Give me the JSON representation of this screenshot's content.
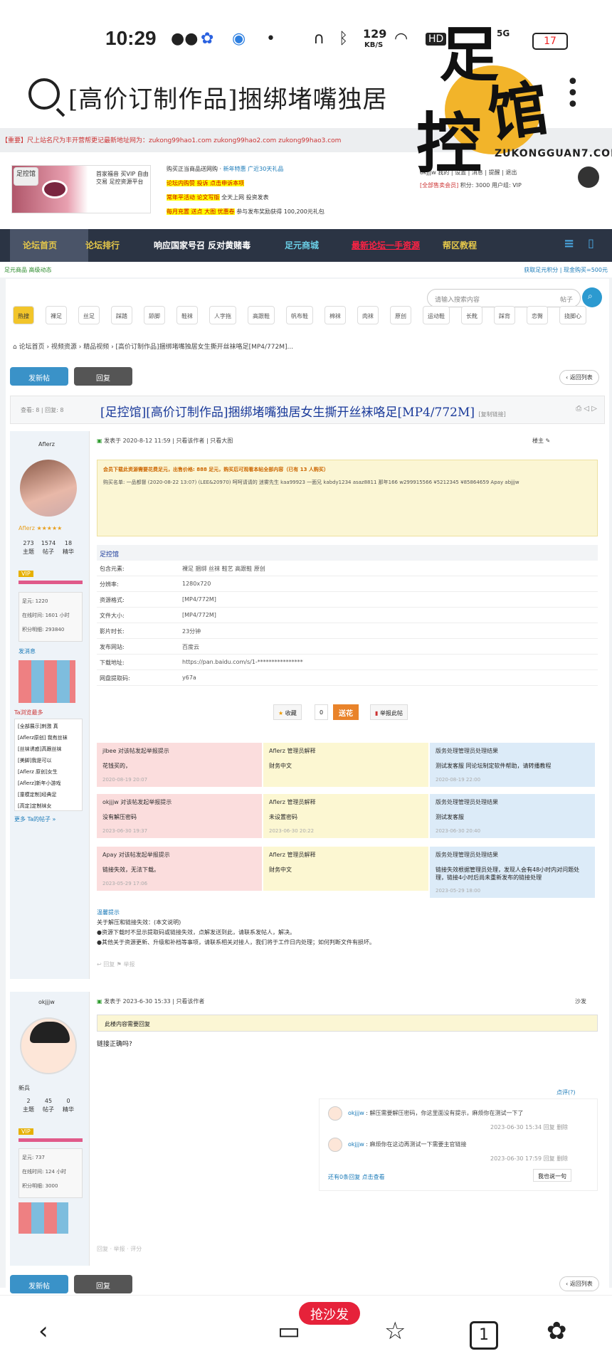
{
  "status": {
    "time": "10:29",
    "speed": "129",
    "speed_unit": "KB/S",
    "network": "5G",
    "battery": "17"
  },
  "search": {
    "title": "[高价订制作品]捆绑堵嘴独居"
  },
  "watermark": {
    "chars": [
      "足",
      "馆",
      "控"
    ],
    "domain": "ZUKONGGUAN7.COM"
  },
  "forum": {
    "notice": "【重要】尺上站名尺为丰开营帮更记最新地址网为：zukong99hao1.com   zukong99hao2.com   zukong99hao3.com",
    "logo_tag": "足控馆",
    "logo_text": "首家福音 买VIP 自由交易 足控资源平台",
    "ads": [
      "购买正当商品送网购",
      "新年特惠 广近30天礼品",
      "论坛内购赞 投诉 点击申诉本项",
      "常年平活动 论文写版",
      "全天上网 投资发表",
      "每月充置 送点 大图 优惠卷",
      "参与发布奖励获得",
      "100,200元礼包"
    ],
    "user": {
      "name": "okjjjw",
      "links": "我的 | 设置 | 消息 | 提醒 | 退出",
      "group": "[全部售卖会员]",
      "points": "积分: 3000",
      "upgrade": "用户组: VIP"
    },
    "nav": [
      "论坛首页",
      "论坛排行",
      "响应国家号召 反对黄赌毒",
      "足元商城",
      "最新论坛一手资源",
      "帮区教程"
    ],
    "subnav_left": "足元商品 高级动态",
    "subnav_right": "获取足元积分 | 现金购买=500元",
    "search_placeholder": "请输入搜索内容",
    "search_scope": "帖子",
    "tags": [
      "热搜",
      "裸足",
      "丝足",
      "踩踏",
      "舔脚",
      "鞋袜",
      "人字拖",
      "高跟鞋",
      "帆布鞋",
      "棉袜",
      "肉袜",
      "原创",
      "运动鞋",
      "长靴",
      "踩背",
      "恋臀",
      "挠脚心"
    ],
    "breadcrumb": "论坛首页 › 视频资源 › 精品视频 › [高价订制作品]捆绑堵嘴独居女生撕开丝袜咯足[MP4/772M]...",
    "btn_post": "发新帖",
    "btn_reply": "回复",
    "btn_back": "返回列表",
    "thread": {
      "views": "查看: 8",
      "replies": "回复: 8",
      "title": "[足控馆][高价订制作品]捆绑堵嘴独居女生撕开丝袜咯足[MP4/772M]",
      "copy": "[复制链接]"
    }
  },
  "post1": {
    "author": "Aflerz",
    "level": "VIP",
    "stats": [
      {
        "v": "273",
        "k": "主题"
      },
      {
        "v": "1574",
        "k": "帖子"
      },
      {
        "v": "18",
        "k": "精华"
      }
    ],
    "info": [
      "足元: 1220",
      "在线时间: 1601 小时",
      "积分明细: 293840"
    ],
    "sections": [
      "发消息",
      "Ta浏览最多"
    ],
    "recent": [
      "[全部展示]刺激 真",
      "[Aflerz原创] 我有丝袜",
      "[丝袜诱惑]高跟丝袜",
      "[美脚]我是可以",
      "[Aflerz 原创]女生",
      "[Aflerz]新年小游戏",
      "[童模定制]经典足",
      "[高定]定制袜女"
    ],
    "more": "更多 Ta的帖子 »",
    "posted": "发表于 2020-8-12 11:59",
    "onlyauthor": "只看该作者",
    "bigmode": "只看大图",
    "floor": "楼主",
    "buy_notice": "会员下载此资源需要花费足元，出售价格: 888 足元，购买后可观看本帖全部内容（已有 13 人购买）",
    "buyers": "购买名单: 一品都督 (2020-08-22 13:07) (LEE&20970) 呵呵请请的 迷雾先生 kaa99923 一面兄 kabdy1234 asaz8811 那年166 w299915566 ¥5212345 ¥85864659 Apay abjjjw",
    "table_head": "足控馆",
    "table": [
      {
        "k": "包含元素:",
        "v": "裸足 捆绑 丝袜 鞋艺 高跟鞋 原创"
      },
      {
        "k": "分辨率:",
        "v": "1280x720"
      },
      {
        "k": "资源格式:",
        "v": "[MP4/772M]"
      },
      {
        "k": "文件大小:",
        "v": "[MP4/772M]"
      },
      {
        "k": "影片时长:",
        "v": "23分钟"
      },
      {
        "k": "发布网站:",
        "v": "百度云"
      },
      {
        "k": "下载地址:",
        "v": "https://pan.baidu.com/s/1-****************"
      },
      {
        "k": "网盘提取码:",
        "v": "y67a"
      }
    ],
    "btn_fav": "收藏",
    "fav_count": "0",
    "btn_flower": "送花",
    "btn_report": "举报此帖",
    "tips": [
      {
        "user": "jlbee 对该帖发起举报提示",
        "body": "花钱买的，",
        "date": "2020-08-19 20:07"
      },
      {
        "user": "Aflerz 管理员解释",
        "body": "财务中文",
        "date": ""
      },
      {
        "user": "版务处理管理员处理结果",
        "body": "测试发客服 同论坛制定软件帮助，请转播教程",
        "date": "2020-08-19 22:00"
      },
      {
        "user": "okjjjw 对该帖发起举报提示",
        "body": "没有解压密码",
        "date": "2023-06-30 19:37"
      },
      {
        "user": "Aflerz 管理员解释",
        "body": "未设置密码",
        "date": "2023-06-30 20:22"
      },
      {
        "user": "版务处理管理员处理结果",
        "body": "测试发客服",
        "date": "2023-06-30 20:40"
      },
      {
        "user": "Apay 对该帖发起举报提示",
        "body": "链接失效，无法下载。",
        "date": "2023-05-29 17:06"
      },
      {
        "user": "Aflerz 管理员解释",
        "body": "财务中文",
        "date": ""
      },
      {
        "user": "版务处理管理员处理结果",
        "body": "链接失效根据管理员处理，发现人会有48小时内对问题处理，链接4小时后尚未重新发布的链接处理",
        "date": "2023-05-29 18:00"
      }
    ],
    "notes_head": "温馨提示",
    "notes": [
      "关于解压和链接失效：(本文说明)",
      "●资源下载时不显示提取码或链接失效，点解发送到此，请联系发帖人，解决。",
      "●其他关于资源更新、升级和补档等事项，请联系相关对接人，我们将于工作日内处理；如何判断文件有损坏。"
    ]
  },
  "post2": {
    "author": "okjjjw",
    "level": "VIP",
    "name2": "新兵",
    "stats": [
      {
        "v": "2",
        "k": "主题"
      },
      {
        "v": "45",
        "k": "帖子"
      },
      {
        "v": "0",
        "k": "精华"
      }
    ],
    "info": [
      "足元: 737",
      "在线时间: 124 小时",
      "积分明细: 3000"
    ],
    "posted": "发表于 2023-6-30 15:33",
    "onlyauthor": "只看该作者",
    "floor": "沙发",
    "hidden": "此楼内容需要回复",
    "body": "链接正确吗?",
    "comments_label": "点评(?)",
    "comments": [
      {
        "user": "okjjjw",
        "text": "解压需要解压密码，你这里面没有提示，麻烦你在测试一下了",
        "date": "2023-06-30 15:34"
      },
      {
        "user": "okjjjw",
        "text": "麻烦你在这边再测试一下需要主官链接",
        "date": "2023-06-30 17:59"
      }
    ],
    "comment_actions": [
      "回复",
      "删除"
    ],
    "cmt_more": "还有0条回复 点击查看",
    "cmt_btn": "我也说一句",
    "actions": [
      "回复",
      "举报",
      "评分"
    ]
  },
  "bottom": {
    "chat_badge": "抢沙发",
    "tabs": "1"
  }
}
